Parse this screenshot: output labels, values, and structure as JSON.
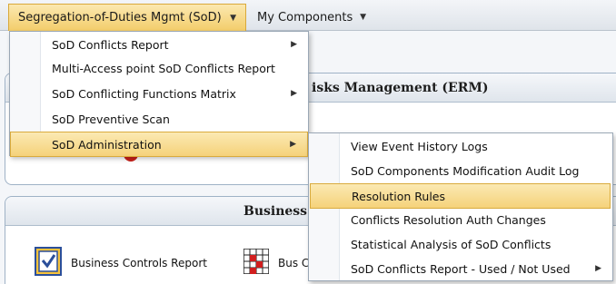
{
  "menubar": {
    "items": [
      {
        "label": "Segregation-of-Duties Mgmt (SoD)"
      },
      {
        "label": "My Components"
      }
    ]
  },
  "panels": {
    "erm_title": "isks Management (ERM)",
    "business_title": "Business C"
  },
  "tiles": [
    {
      "label": "Business Controls Report",
      "icon": "checkbox-report-icon"
    },
    {
      "label": "Bus C",
      "icon": "grid-matrix-icon"
    }
  ],
  "sod_menu": {
    "items": [
      {
        "label": "SoD Conflicts Report",
        "submenu": true
      },
      {
        "label": "Multi-Access point SoD Conflicts Report",
        "submenu": false
      },
      {
        "label": "SoD Conflicting Functions Matrix",
        "submenu": true
      },
      {
        "label": "SoD Preventive Scan",
        "submenu": false
      },
      {
        "label": "SoD Administration",
        "submenu": true,
        "highlighted": true
      }
    ]
  },
  "admin_submenu": {
    "items": [
      {
        "label": "View Event History Logs",
        "submenu": false
      },
      {
        "label": "SoD Components Modification Audit Log",
        "submenu": false
      },
      {
        "label": "Resolution Rules",
        "submenu": false,
        "highlighted": true
      },
      {
        "label": "Conflicts Resolution Auth Changes",
        "submenu": false
      },
      {
        "label": "Statistical Analysis of SoD Conflicts",
        "submenu": false
      },
      {
        "label": "SoD Conflicts Report - Used / Not Used",
        "submenu": true
      }
    ]
  },
  "colors": {
    "highlight": "#f5d27a",
    "panel_border": "#9fb2c6",
    "accent_red": "#c9211b"
  }
}
